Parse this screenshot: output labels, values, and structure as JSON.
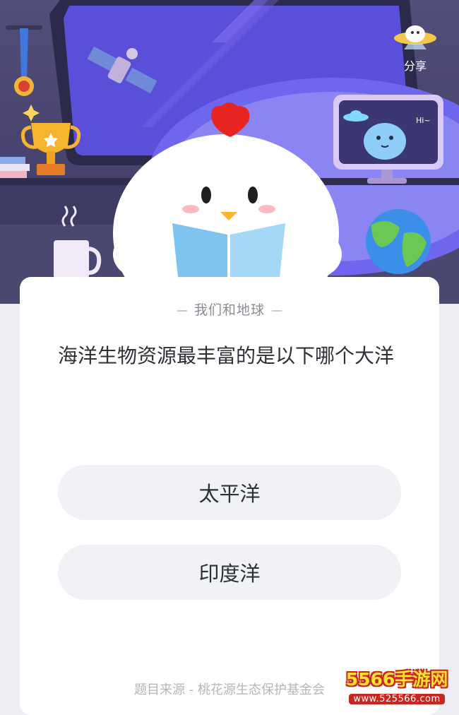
{
  "header": {
    "share_label": "分享"
  },
  "quiz": {
    "category": "我们和地球",
    "question": "海洋生物资源最丰富的是以下哪个大洋",
    "options": [
      {
        "label": "太平洋"
      },
      {
        "label": "印度洋"
      }
    ],
    "source": "题目来源 - 桃花源生态保护基金会"
  },
  "watermark": {
    "top": "5566手游网",
    "bottom": "www.525566.com"
  },
  "scene": {
    "screen_greeting": "Hi~"
  }
}
